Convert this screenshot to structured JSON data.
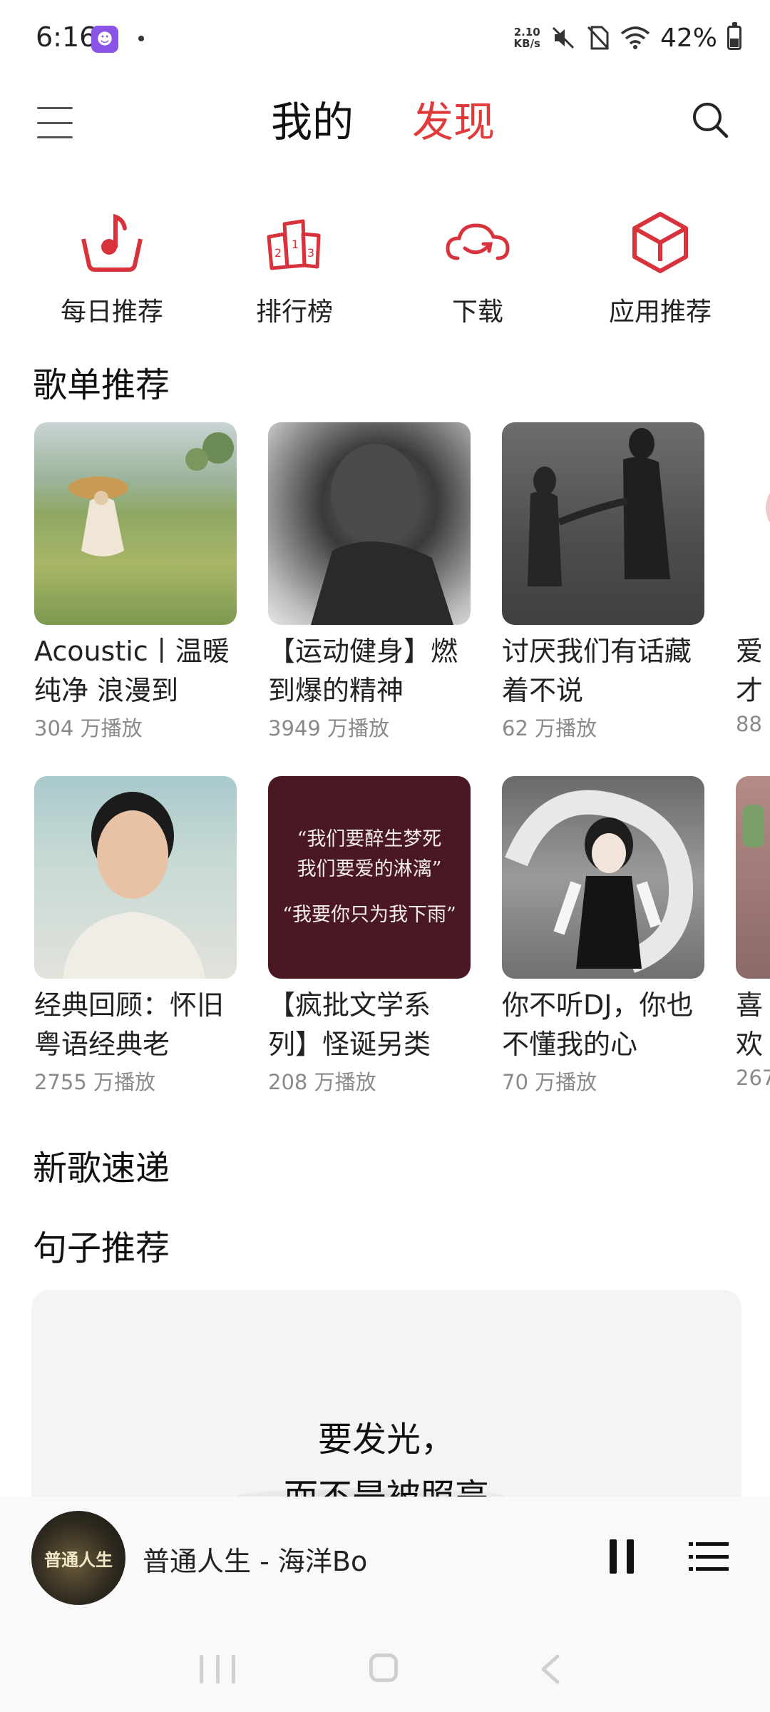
{
  "status_bar": {
    "time": "6:16",
    "net_speed_value": "2.10",
    "net_speed_unit": "KB/s",
    "battery_text": "42%",
    "battery_level": 0.42
  },
  "nav": {
    "tab_mine": "我的",
    "tab_discover": "发现",
    "accent_color": "#e03a3a"
  },
  "quick_entries": [
    {
      "label": "每日推荐",
      "icon": "music-note-bowl-icon"
    },
    {
      "label": "排行榜",
      "icon": "podium-icon"
    },
    {
      "label": "下载",
      "icon": "cloud-download-icon"
    },
    {
      "label": "应用推荐",
      "icon": "cube-icon"
    }
  ],
  "sections": {
    "playlists_title": "歌单推荐",
    "new_songs_title": "新歌速递",
    "quotes_title": "句子推荐"
  },
  "playlists_row1": [
    {
      "title": "Acoustic丨温暖纯净 浪漫到",
      "plays": "304 万播放"
    },
    {
      "title": "【运动健身】燃到爆的精神",
      "plays": "3949 万播放"
    },
    {
      "title": "讨厌我们有话藏着不说",
      "plays": "62 万播放"
    },
    {
      "title": "爱才解的",
      "plays": "88"
    }
  ],
  "playlists_row2": [
    {
      "title": "经典回顾：怀旧粤语经典老",
      "plays": "2755 万播放"
    },
    {
      "title": "【疯批文学系列】怪诞另类",
      "plays": "208 万播放"
    },
    {
      "title": "你不听DJ，你也不懂我的心",
      "plays": "70 万播放"
    },
    {
      "title": "喜欢你",
      "plays": "267"
    }
  ],
  "quote_cover": {
    "line1": "“我们要醉生梦死",
    "line2": "我们要爱的淋漓”",
    "line3": "“我要你只为我下雨”"
  },
  "quote_card": {
    "line1": "要发光，",
    "line2": "而不是被照亮"
  },
  "player": {
    "cover_text": "普通人生",
    "title": "普通人生 - 海洋Bo"
  }
}
